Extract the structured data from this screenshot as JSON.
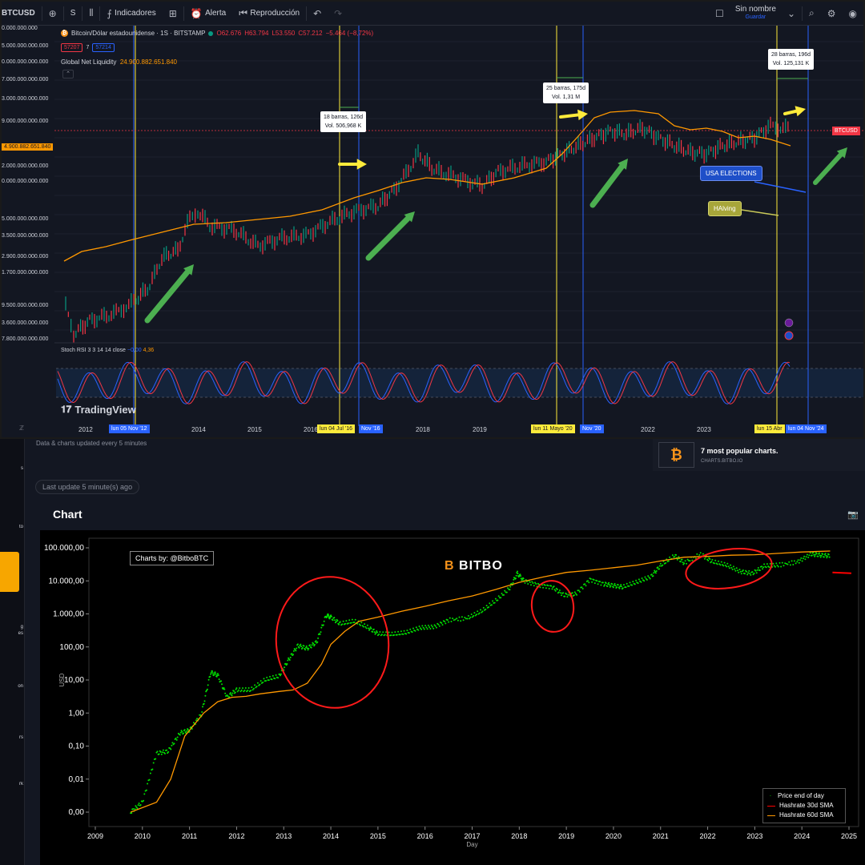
{
  "toolbar": {
    "symbol": "BTCUSD",
    "interval": "S",
    "indicators_label": "Indicadores",
    "alert_label": "Alerta",
    "replay_label": "Reproducción",
    "user_label": "Sin nombre",
    "save_label": "Guardar"
  },
  "tv": {
    "legend": {
      "title": "Bitcoin/Dólar estadounidense · 1S · BITSTAMP",
      "open": "O62.676",
      "high": "H63.794",
      "low": "L53.550",
      "close": "C57.212",
      "change": "−5.464 (−8,72%)",
      "bid": "57207",
      "spread": "7",
      "ask": "57214"
    },
    "gnl_label": "Global Net Liquidity",
    "gnl_value": "24.900.882.651.840",
    "gnl_tag": "4.900.882.651.840",
    "btc_tag": "BTCUSD",
    "y_axis_labels": [
      "0.000.000.000",
      "5.000.000.000.000",
      "0.000.000.000.000",
      "7.000.000.000.000",
      "3.000.000.000.000",
      "9.000.000.000.000",
      "2.000.000.000.000",
      "0.000.000.000.000",
      "5.000.000.000.000",
      "3.500.000.000.000",
      "2.900.000.000.000",
      "1.700.000.000.000",
      "9.500.000.000.000",
      "3.600.000.000.000",
      "7.800.000.000.000"
    ],
    "stoch_label": "Stoch RSI",
    "stoch_params": "3 3 14 14 close",
    "stoch_k": "−0,00",
    "stoch_d": "4,36",
    "logo": "TradingView",
    "years": [
      "2012",
      "2014",
      "2015",
      "2016",
      "2018",
      "2019",
      "2022",
      "2023"
    ],
    "date_tags": {
      "d1": "lun 05 Nov '12",
      "d2": "lun 04 Jul '16",
      "d3": "Nov '16",
      "d4": "lun 11 Mayo '20",
      "d5": "Nov '20",
      "d6": "lun 15 Abr",
      "d7": "lun 04 Nov '24"
    },
    "measures": [
      {
        "line1": "18 barras, 126d",
        "line2": "Vol. 506,968 K"
      },
      {
        "line1": "25 barras, 175d",
        "line2": "Vol. 1,31 M"
      },
      {
        "line1": "28 barras, 196d",
        "line2": "Vol. 125,131 K"
      }
    ],
    "callouts": {
      "elections": "USA ELECTIONS",
      "halving": "HAlving"
    },
    "colors": {
      "liquidity": "#ff9800",
      "halving_line": "#ffeb3b",
      "election_line": "#2962ff",
      "candle_up": "#089981",
      "candle_down": "#f23645",
      "arrow_green": "#4caf50",
      "arrow_yellow": "#ffeb3b"
    }
  },
  "bitbo": {
    "updated_text": "Data & charts updated every 5 minutes",
    "popular_title": "7 most popular charts.",
    "popular_sub": "CHARTS.BITBO.IO",
    "last_update": "Last update 5 minute(s) ago",
    "chart_title": "Chart",
    "charts_by": "Charts by: @BitboBTC",
    "watermark": "BITBO",
    "sidebar_labels": [
      "s",
      "to",
      "g",
      "es",
      "on",
      "rs",
      "rk"
    ]
  },
  "chart_data": {
    "type": "line",
    "xlabel": "Day",
    "ylabel": "USD",
    "yscale": "log",
    "y_tick_labels": [
      "0,00",
      "0,01",
      "0,10",
      "1,00",
      "10,00",
      "100,00",
      "1.000,00",
      "10.000,00",
      "100.000,00"
    ],
    "x_tick_labels": [
      "2009",
      "2010",
      "2011",
      "2012",
      "2013",
      "2014",
      "2015",
      "2016",
      "2017",
      "2018",
      "2019",
      "2020",
      "2021",
      "2022",
      "2023",
      "2024",
      "2025"
    ],
    "ylim": [
      0.001,
      100000
    ],
    "series": [
      {
        "name": "Price end of day",
        "color": "#00e000",
        "style": "dots",
        "x": [
          2009.75,
          2010.0,
          2010.3,
          2010.55,
          2010.8,
          2011.0,
          2011.25,
          2011.45,
          2011.6,
          2011.8,
          2012.0,
          2012.3,
          2012.6,
          2012.9,
          2013.1,
          2013.3,
          2013.5,
          2013.7,
          2013.9,
          2014.0,
          2014.2,
          2014.5,
          2014.8,
          2015.0,
          2015.3,
          2015.6,
          2015.9,
          2016.2,
          2016.5,
          2016.9,
          2017.2,
          2017.5,
          2017.8,
          2017.96,
          2018.1,
          2018.4,
          2018.7,
          2018.95,
          2019.2,
          2019.5,
          2019.8,
          2020.0,
          2020.2,
          2020.5,
          2020.8,
          2021.0,
          2021.3,
          2021.5,
          2021.85,
          2022.1,
          2022.4,
          2022.7,
          2022.95,
          2023.2,
          2023.5,
          2023.9,
          2024.2,
          2024.4,
          2024.6
        ],
        "y": [
          0.001,
          0.002,
          0.06,
          0.07,
          0.25,
          0.3,
          0.9,
          17,
          14,
          3,
          5,
          5,
          10,
          13,
          40,
          110,
          90,
          140,
          900,
          800,
          500,
          600,
          380,
          250,
          240,
          270,
          380,
          410,
          650,
          740,
          1200,
          2500,
          6000,
          17000,
          10000,
          7500,
          6500,
          3700,
          4000,
          11000,
          8000,
          7200,
          6500,
          9200,
          13500,
          29000,
          58000,
          35000,
          64000,
          38000,
          30000,
          19000,
          16800,
          28000,
          30000,
          37000,
          65000,
          60000,
          57000
        ]
      },
      {
        "name": "Hashrate 30d SMA",
        "color": "#ff0000",
        "x": [
          2024.65,
          2025.05
        ],
        "y": [
          18000,
          17000
        ]
      },
      {
        "name": "Hashrate 60d SMA",
        "color": "#ff9800",
        "x": [
          2009.75,
          2010.3,
          2010.6,
          2010.9,
          2011.3,
          2011.6,
          2011.9,
          2012.2,
          2012.5,
          2012.9,
          2013.2,
          2013.5,
          2013.8,
          2014.0,
          2014.3,
          2014.6,
          2015.0,
          2015.5,
          2016.0,
          2016.5,
          2017.0,
          2017.5,
          2018.0,
          2018.5,
          2019.0,
          2019.5,
          2020.0,
          2020.5,
          2021.0,
          2021.5,
          2022.0,
          2022.5,
          2023.0,
          2023.5,
          2024.0,
          2024.6
        ],
        "y": [
          0.001,
          0.002,
          0.01,
          0.2,
          1.0,
          2.2,
          3.0,
          3.2,
          3.8,
          4.5,
          5,
          8,
          30,
          120,
          300,
          600,
          800,
          1200,
          1700,
          2500,
          3500,
          5500,
          9000,
          13000,
          18000,
          21000,
          25000,
          30000,
          40000,
          52000,
          55000,
          60000,
          62000,
          68000,
          75000,
          80000
        ]
      }
    ],
    "legend_position": "bottom-right"
  }
}
